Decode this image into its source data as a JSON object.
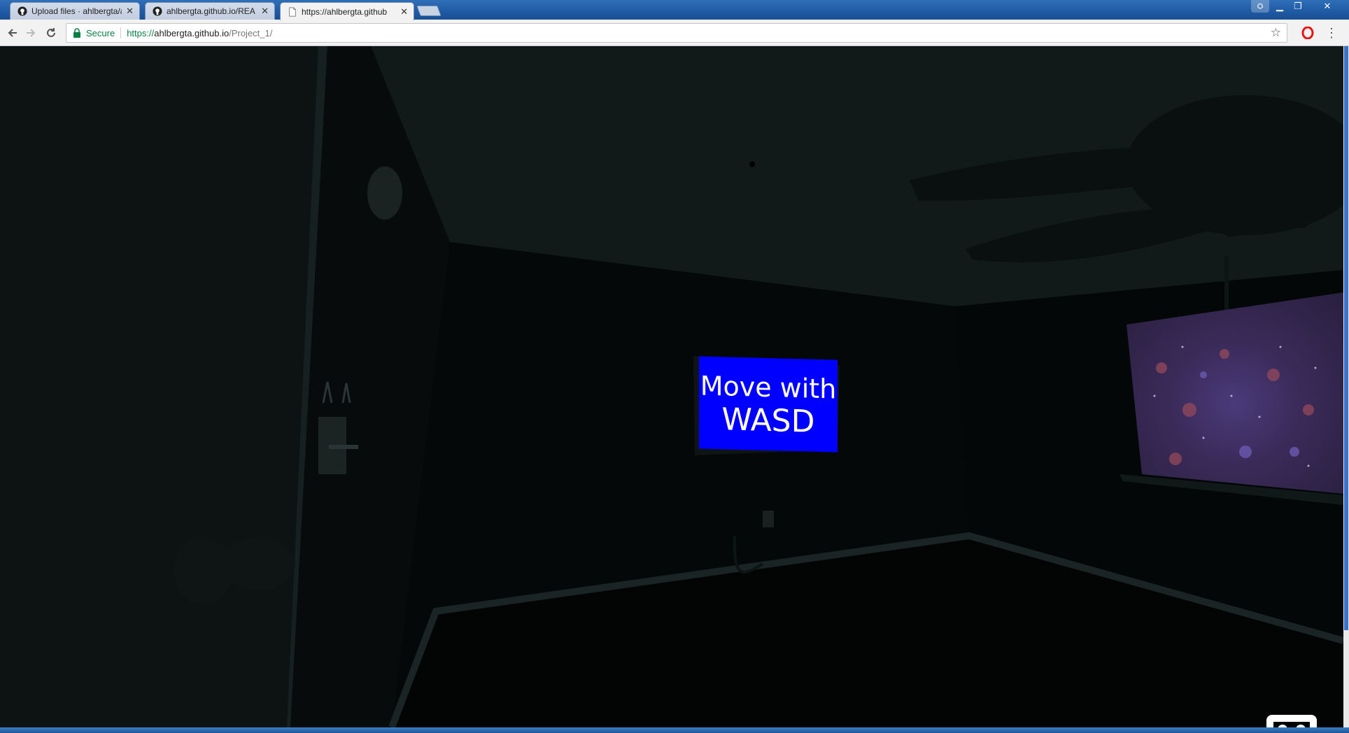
{
  "browser": {
    "tabs": [
      {
        "label": "Upload files · ahlbergta/a",
        "icon": "github-icon",
        "active": false
      },
      {
        "label": "ahlbergta.github.io/REA",
        "icon": "github-icon",
        "active": false
      },
      {
        "label": "https://ahlbergta.github",
        "icon": "page-icon",
        "active": true
      }
    ],
    "address_bar": {
      "security_label": "Secure",
      "url_scheme": "https://",
      "url_host": "ahlbergta.github.io",
      "url_path": "/Project_1/"
    },
    "icons": {
      "back": "back-arrow-icon",
      "forward": "forward-arrow-icon",
      "reload": "reload-icon",
      "bookmark": "star-icon",
      "extension": "opera-icon",
      "menu": "kebab-menu-icon"
    },
    "colors": {
      "secure_green": "#0b8043",
      "tab_strip_blue": "#1f5aa3"
    }
  },
  "scene": {
    "sign": {
      "line1": "Move with",
      "line2": "WASD",
      "background": "#0000ff"
    },
    "vr_button_icon": "vr-headset-icon"
  }
}
